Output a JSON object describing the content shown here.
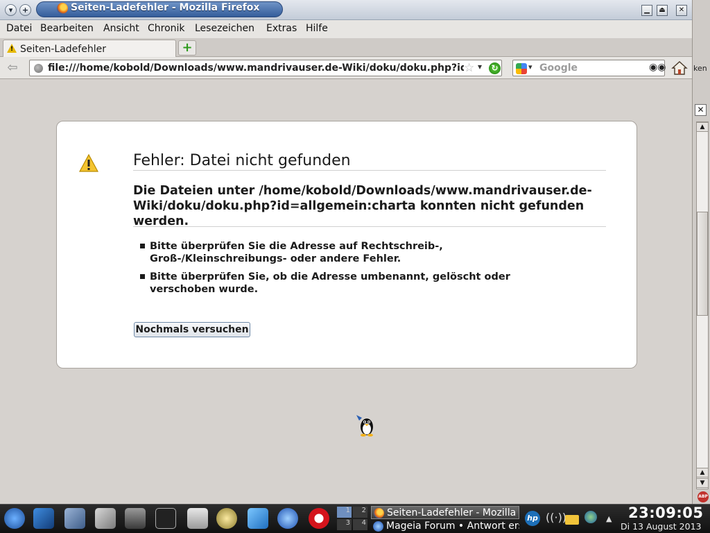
{
  "window": {
    "title": "Seiten-Ladefehler - Mozilla Firefox"
  },
  "menubar": {
    "items": [
      "Datei",
      "Bearbeiten",
      "Ansicht",
      "Chronik",
      "Lesezeichen",
      "Extras",
      "Hilfe"
    ]
  },
  "tabs": [
    {
      "label": "Seiten-Ladefehler",
      "icon": "warning-icon",
      "active": true
    }
  ],
  "navbar": {
    "url": "file:///home/kobold/Downloads/www.mandrivauser.de-Wiki/doku/doku.php?id=allgemein:charta",
    "search_placeholder": "Google"
  },
  "sidebar_cut_label": "ken",
  "error": {
    "title": "Fehler: Datei nicht gefunden",
    "description": "Die Dateien unter /home/kobold/Downloads/www.mandrivauser.de-Wiki/doku/doku.php?id=allgemein:charta konnten nicht gefunden werden.",
    "hints": [
      "Bitte überprüfen Sie die Adresse auf Rechtschreib-, Groß-/Kleinschreibungs- oder andere Fehler.",
      "Bitte überprüfen Sie, ob die Adresse umbenannt, gelöscht oder verschoben wurde."
    ],
    "retry_label": "Nochmals versuchen"
  },
  "taskbar": {
    "pager_labels": [
      "1",
      "2",
      "3",
      "4"
    ],
    "tasks": [
      {
        "label": "Seiten-Ladefehler - Mozilla Firefox",
        "active": true
      },
      {
        "label": "Mageia Forum • Antwort erstellen",
        "active": false
      }
    ],
    "tray_icons": [
      "hp-icon",
      "wireless-icon",
      "folder-icon",
      "network-globe-icon",
      "tray-expand-icon"
    ],
    "clock": "23:09:05",
    "date": "Di  13 August 2013"
  },
  "colors": {
    "titlebar_accent": "#345d9b",
    "panel_bg": "#ffffff",
    "page_bg": "#d6d2ce",
    "reload_green": "#1f7d12",
    "taskbar_bg": "#111111"
  }
}
